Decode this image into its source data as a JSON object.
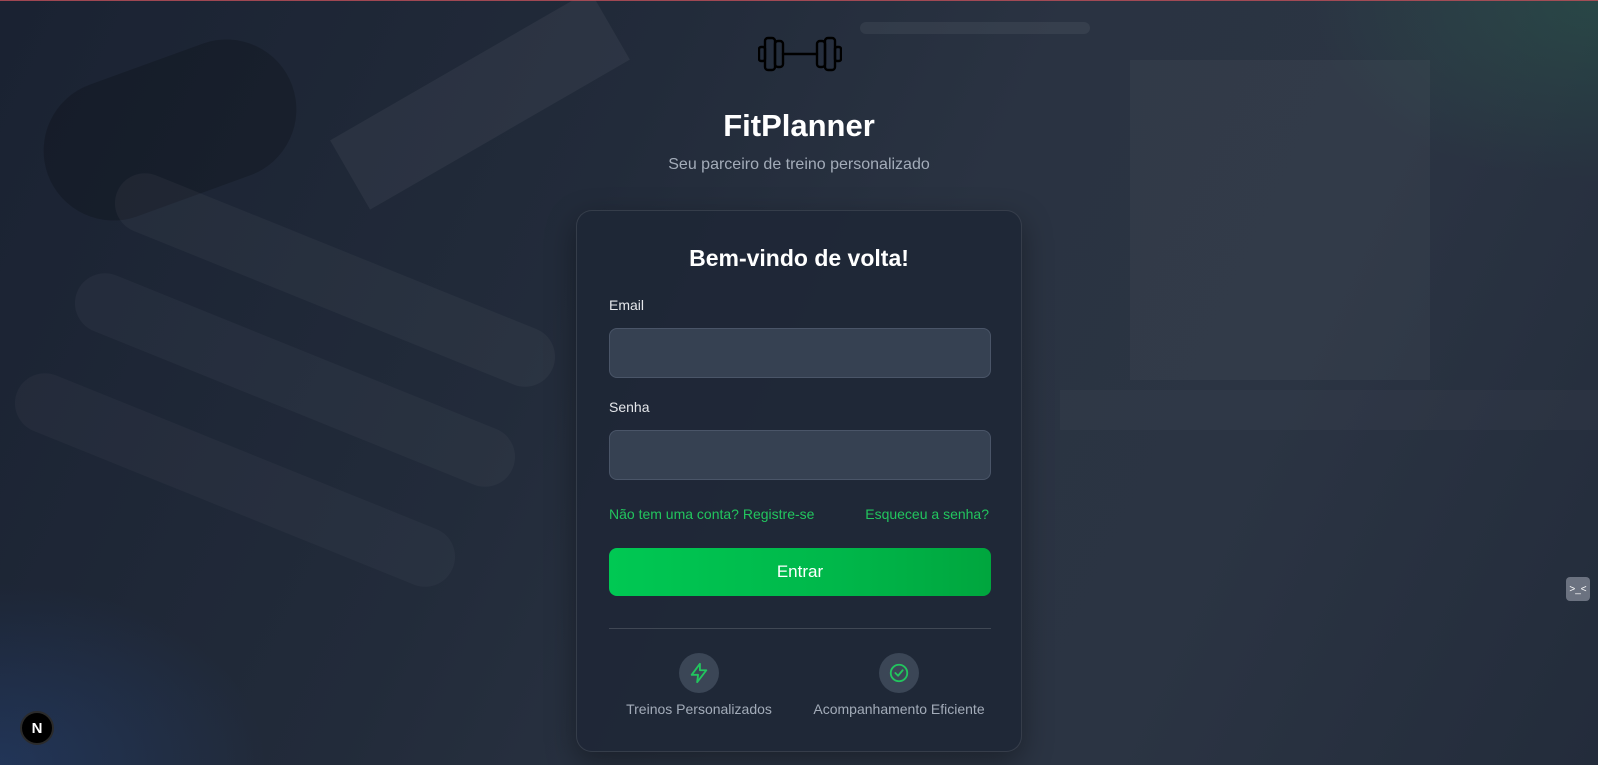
{
  "app": {
    "title": "FitPlanner",
    "subtitle": "Seu parceiro de treino personalizado",
    "logo_icon": "dumbbell-icon"
  },
  "login_card": {
    "title": "Bem-vindo de volta!",
    "email_label": "Email",
    "email_value": "",
    "password_label": "Senha",
    "password_value": "",
    "register_link": "Não tem uma conta? Registre-se",
    "forgot_link": "Esqueceu a senha?",
    "submit_label": "Entrar"
  },
  "features": [
    {
      "label": "Treinos Personalizados",
      "icon": "lightning-icon"
    },
    {
      "label": "Acompanhamento Eficiente",
      "icon": "check-circle-icon"
    }
  ],
  "dev_badge": {
    "label": "N",
    "icon": "nextjs-icon"
  },
  "side_widget": {
    "icon": "code-toggle-icon",
    "label": ">_<"
  },
  "colors": {
    "accent": "#22c55e",
    "button": "#00c853",
    "card_bg": "#1e2736",
    "input_bg": "#364152"
  }
}
